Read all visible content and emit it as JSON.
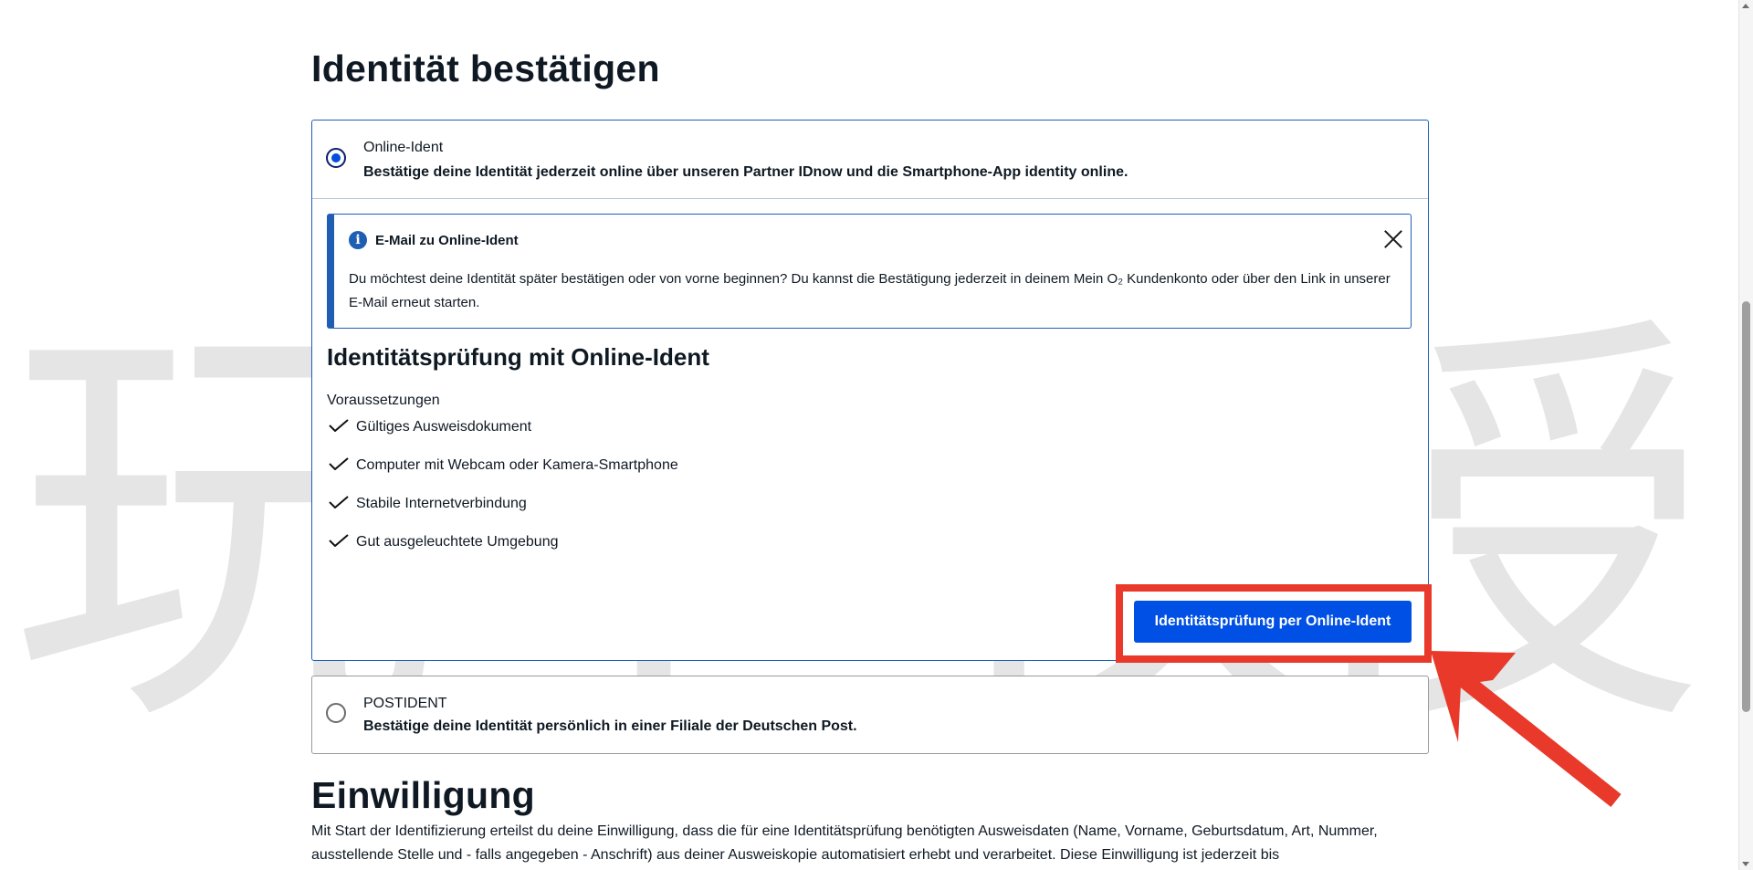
{
  "identity": {
    "title": "Identität bestätigen",
    "online": {
      "title": "Online-Ident",
      "description": "Bestätige deine Identität jederzeit online über unseren Partner IDnow und die Smartphone-App identity online.",
      "selected": true
    },
    "info_box": {
      "icon": "info-icon",
      "title": "E-Mail zu Online-Ident",
      "text": "Du möchtest deine Identität später bestätigen oder von vorne beginnen? Du kannst die Bestätigung jederzeit in deinem Mein O₂ Kundenkonto oder über den Link in unserer E-Mail erneut starten."
    },
    "check": {
      "heading": "Identitätsprüfung mit Online-Ident",
      "requirements_label": "Voraussetzungen",
      "requirements": [
        "Gültiges Ausweisdokument",
        "Computer mit Webcam oder Kamera-Smartphone",
        "Stabile Internetverbindung",
        "Gut ausgeleuchtete Umgebung"
      ],
      "button_label": "Identitätsprüfung per Online-Ident"
    },
    "postident": {
      "title": "POSTIDENT",
      "description": "Bestätige deine Identität persönlich in einer Filiale der Deutschen Post.",
      "selected": false
    }
  },
  "consent": {
    "title": "Einwilligung",
    "text": "Mit Start der Identifizierung erteilst du deine Einwilligung, dass die für eine Identitätsprüfung benötigten Ausweisdaten (Name, Vorname, Geburtsdatum, Art, Nummer, ausstellende Stelle und - falls angegeben - Anschrift) aus deiner Ausweiskopie automatisiert erhebt und verarbeitet. Diese Einwilligung ist jederzeit bis"
  },
  "watermark": {
    "glyphs": [
      "玩",
      "卡",
      "教",
      "授"
    ],
    "color": "#b4b4b4"
  },
  "annotation": {
    "highlight_color": "#e8392a"
  },
  "colors": {
    "primary_button": "#0050e6",
    "selected_border": "#1d5fb8",
    "info_accent": "#1f5eb3"
  }
}
